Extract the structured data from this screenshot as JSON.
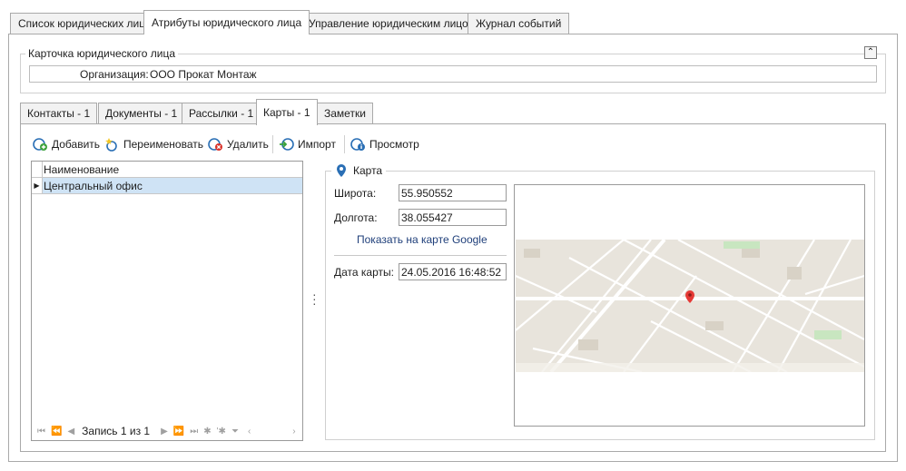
{
  "top_tabs": [
    {
      "label": "Список юридических лиц",
      "active": false
    },
    {
      "label": "Атрибуты юридического лица",
      "active": true
    },
    {
      "label": "Управление юридическим лицом",
      "active": false
    },
    {
      "label": "Журнал событий",
      "active": false
    }
  ],
  "card": {
    "title": "Карточка юридического лица",
    "org_label": "Организация:",
    "org_value": "ООО Прокат Монтаж"
  },
  "inner_tabs": [
    {
      "label": "Контакты - 1",
      "active": false
    },
    {
      "label": "Документы - 1",
      "active": false
    },
    {
      "label": "Рассылки - 1",
      "active": false
    },
    {
      "label": "Карты - 1",
      "active": true
    },
    {
      "label": "Заметки",
      "active": false
    }
  ],
  "toolbar": {
    "add": "Добавить",
    "rename": "Переименовать",
    "delete": "Удалить",
    "import": "Импорт",
    "view": "Просмотр"
  },
  "grid": {
    "column": "Наименование",
    "rows": [
      "Центральный офис"
    ],
    "record_text": "Запись 1 из 1"
  },
  "map": {
    "title": "Карта",
    "lat_label": "Широта:",
    "lat_value": "55.950552",
    "lon_label": "Долгота:",
    "lon_value": "38.055427",
    "google_link": "Показать на карте Google",
    "date_label": "Дата карты:",
    "date_value": "24.05.2016 16:48:52"
  },
  "colors": {
    "accent": "#2a6fb5",
    "selected_row": "#cfe3f5",
    "map_bg": "#e8e4dc",
    "marker": "#e53935"
  }
}
